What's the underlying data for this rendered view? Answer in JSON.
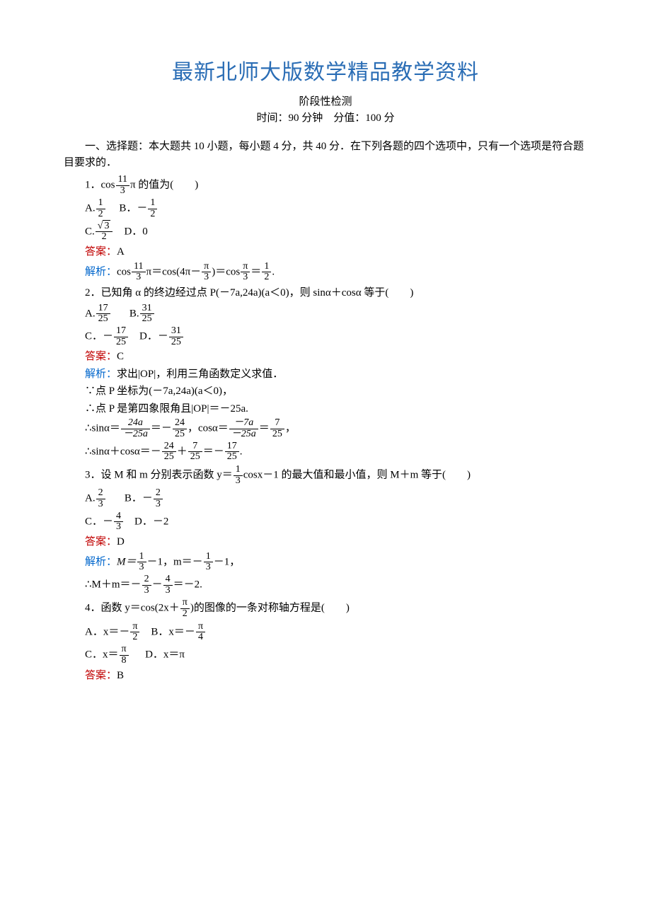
{
  "title": "最新北师大版数学精品教学资料",
  "subtitle": "阶段性检测",
  "timing": "时间：90 分钟　分值：100 分",
  "sectionHead": "一、选择题：本大题共 10 小题，每小题 4 分，共 40 分．在下列各题的四个选项中，只有一个选项是符合题目要求的．",
  "q1": {
    "stem_a": "1．cos",
    "stem_b": "π 的值为(　　)",
    "fracNum": "11",
    "fracDen": "3",
    "optA_a": "A.",
    "optA_num": "1",
    "optA_den": "2",
    "optB_a": "B．－",
    "optB_num": "1",
    "optB_den": "2",
    "optC_a": "C.",
    "optC_num_sqrt": "3",
    "optC_den": "2",
    "optD": "D．0",
    "ansLabel": "答案：",
    "ans": "A",
    "expLabel": "解析：",
    "exp_a": "cos",
    "exp_f1n": "11",
    "exp_f1d": "3",
    "exp_b": "π＝cos(4π－",
    "exp_f2n": "π",
    "exp_f2d": "3",
    "exp_c": ")＝cos",
    "exp_f3n": "π",
    "exp_f3d": "3",
    "exp_d": "＝",
    "exp_f4n": "1",
    "exp_f4d": "2",
    "exp_e": "."
  },
  "q2": {
    "stem": "2．已知角 α 的终边经过点 P(－7a,24a)(a＜0)，则 sinα＋cosα 等于(　　)",
    "optA_a": "A.",
    "optA_num": "17",
    "optA_den": "25",
    "optB_a": "B.",
    "optB_num": "31",
    "optB_den": "25",
    "optC_a": "C．－",
    "optC_num": "17",
    "optC_den": "25",
    "optD_a": "D．－",
    "optD_num": "31",
    "optD_den": "25",
    "ansLabel": "答案：",
    "ans": "C",
    "expLabel": "解析：",
    "exp1": "求出|OP|，利用三角函数定义求值．",
    "exp2": "∵点 P 坐标为(－7a,24a)(a＜0)，",
    "exp3": "∴点 P 是第四象限角且|OP|＝－25a.",
    "exp4a": "∴sinα＝",
    "exp4f1n": "24a",
    "exp4f1d": "－25a",
    "exp4b": "＝－",
    "exp4f2n": "24",
    "exp4f2d": "25",
    "exp4c": "，cosα＝",
    "exp4f3n": "－7a",
    "exp4f3d": "－25a",
    "exp4d": "＝",
    "exp4f4n": "7",
    "exp4f4d": "25",
    "exp4e": "，",
    "exp5a": "∴sinα＋cosα＝－",
    "exp5f1n": "24",
    "exp5f1d": "25",
    "exp5b": "＋",
    "exp5f2n": "7",
    "exp5f2d": "25",
    "exp5c": "＝－",
    "exp5f3n": "17",
    "exp5f3d": "25",
    "exp5d": "."
  },
  "q3": {
    "stem_a": "3．设 M 和 m 分别表示函数 y＝",
    "stem_f1n": "1",
    "stem_f1d": "3",
    "stem_b": "cosx－1 的最大值和最小值，则 M＋m 等于(　　)",
    "optA_a": "A.",
    "optA_num": "2",
    "optA_den": "3",
    "optB_a": "B．－",
    "optB_num": "2",
    "optB_den": "3",
    "optC_a": "C．－",
    "optC_num": "4",
    "optC_den": "3",
    "optD": "D．－2",
    "ansLabel": "答案：",
    "ans": "D",
    "expLabel": "解析：",
    "exp1a": "M＝",
    "exp1f1n": "1",
    "exp1f1d": "3",
    "exp1b": "－1，m＝－",
    "exp1f2n": "1",
    "exp1f2d": "3",
    "exp1c": "－1，",
    "exp2a": "∴M＋m＝－",
    "exp2f1n": "2",
    "exp2f1d": "3",
    "exp2b": "－",
    "exp2f2n": "4",
    "exp2f2d": "3",
    "exp2c": "＝－2."
  },
  "q4": {
    "stem_a": "4．函数 y＝cos(2x＋",
    "stem_f1n": "π",
    "stem_f1d": "2",
    "stem_b": ")的图像的一条对称轴方程是(　　)",
    "optA_a": "A．x＝－",
    "optA_num": "π",
    "optA_den": "2",
    "optB_a": "B．x＝－",
    "optB_num": "π",
    "optB_den": "4",
    "optC_a": "C．x＝",
    "optC_num": "π",
    "optC_den": "8",
    "optD": "D．x＝π",
    "ansLabel": "答案：",
    "ans": "B"
  }
}
